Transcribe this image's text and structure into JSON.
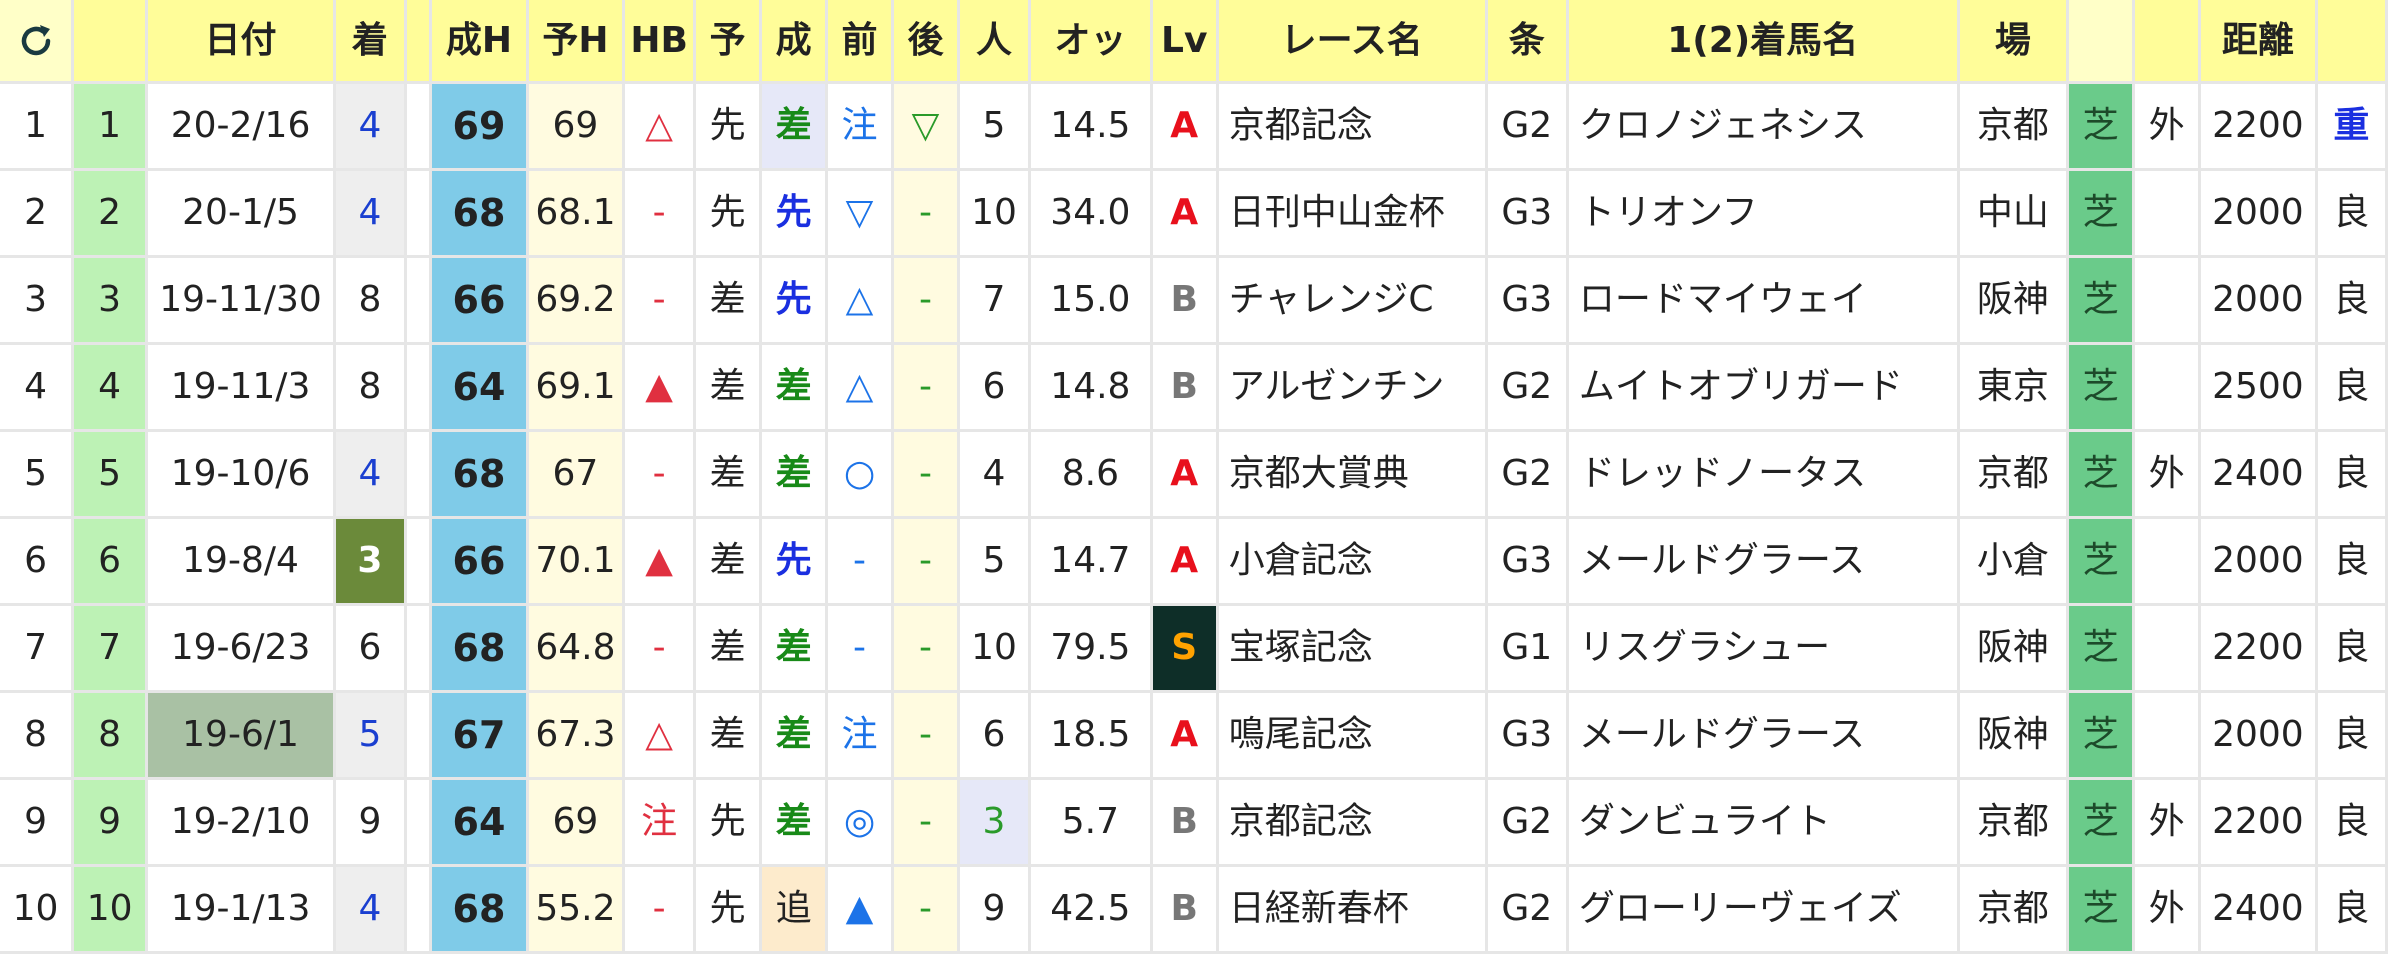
{
  "headers": {
    "date": "日付",
    "finish": "着",
    "seih": "成H",
    "yoh": "予H",
    "hb": "HB",
    "yo": "予",
    "sei": "成",
    "mae": "前",
    "ato": "後",
    "pop": "人",
    "odds": "オッ",
    "lv": "Lv",
    "race": "レース名",
    "jo": "条",
    "winner": "1(2)着馬名",
    "venue": "場",
    "dist": "距離"
  },
  "rows": [
    {
      "no": "1",
      "idx": "1",
      "date": "20-2/16",
      "finish": "4",
      "seih": "69",
      "yoh": "69",
      "hb": "△",
      "yo": "先",
      "sei": "差",
      "mae": "注",
      "ato": "▽",
      "pop": "5",
      "odds": "14.5",
      "lv": "A",
      "race": "京都記念",
      "jo": "G2",
      "winner": "クロノジェネシス",
      "venue": "京都",
      "surface": "芝",
      "course": "外",
      "dist": "2200",
      "cond": "重"
    },
    {
      "no": "2",
      "idx": "2",
      "date": "20-1/5",
      "finish": "4",
      "seih": "68",
      "yoh": "68.1",
      "hb": "-",
      "yo": "先",
      "sei": "先",
      "mae": "▽",
      "ato": "-",
      "pop": "10",
      "odds": "34.0",
      "lv": "A",
      "race": "日刊中山金杯",
      "jo": "G3",
      "winner": "トリオンフ",
      "venue": "中山",
      "surface": "芝",
      "course": "",
      "dist": "2000",
      "cond": "良"
    },
    {
      "no": "3",
      "idx": "3",
      "date": "19-11/30",
      "finish": "8",
      "seih": "66",
      "yoh": "69.2",
      "hb": "-",
      "yo": "差",
      "sei": "先",
      "mae": "△",
      "ato": "-",
      "pop": "7",
      "odds": "15.0",
      "lv": "B",
      "race": "チャレンジC",
      "jo": "G3",
      "winner": "ロードマイウェイ",
      "venue": "阪神",
      "surface": "芝",
      "course": "",
      "dist": "2000",
      "cond": "良"
    },
    {
      "no": "4",
      "idx": "4",
      "date": "19-11/3",
      "finish": "8",
      "seih": "64",
      "yoh": "69.1",
      "hb": "▲",
      "yo": "差",
      "sei": "差",
      "mae": "△",
      "ato": "-",
      "pop": "6",
      "odds": "14.8",
      "lv": "B",
      "race": "アルゼンチン",
      "jo": "G2",
      "winner": "ムイトオブリガード",
      "venue": "東京",
      "surface": "芝",
      "course": "",
      "dist": "2500",
      "cond": "良"
    },
    {
      "no": "5",
      "idx": "5",
      "date": "19-10/6",
      "finish": "4",
      "seih": "68",
      "yoh": "67",
      "hb": "-",
      "yo": "差",
      "sei": "差",
      "mae": "○",
      "ato": "-",
      "pop": "4",
      "odds": "8.6",
      "lv": "A",
      "race": "京都大賞典",
      "jo": "G2",
      "winner": "ドレッドノータス",
      "venue": "京都",
      "surface": "芝",
      "course": "外",
      "dist": "2400",
      "cond": "良"
    },
    {
      "no": "6",
      "idx": "6",
      "date": "19-8/4",
      "finish": "3",
      "seih": "66",
      "yoh": "70.1",
      "hb": "▲",
      "yo": "差",
      "sei": "先",
      "mae": "-",
      "ato": "-",
      "pop": "5",
      "odds": "14.7",
      "lv": "A",
      "race": "小倉記念",
      "jo": "G3",
      "winner": "メールドグラース",
      "venue": "小倉",
      "surface": "芝",
      "course": "",
      "dist": "2000",
      "cond": "良"
    },
    {
      "no": "7",
      "idx": "7",
      "date": "19-6/23",
      "finish": "6",
      "seih": "68",
      "yoh": "64.8",
      "hb": "-",
      "yo": "差",
      "sei": "差",
      "mae": "-",
      "ato": "-",
      "pop": "10",
      "odds": "79.5",
      "lv": "S",
      "race": "宝塚記念",
      "jo": "G1",
      "winner": "リスグラシュー",
      "venue": "阪神",
      "surface": "芝",
      "course": "",
      "dist": "2200",
      "cond": "良"
    },
    {
      "no": "8",
      "idx": "8",
      "date": "19-6/1",
      "finish": "5",
      "seih": "67",
      "yoh": "67.3",
      "hb": "△",
      "yo": "差",
      "sei": "差",
      "mae": "注",
      "ato": "-",
      "pop": "6",
      "odds": "18.5",
      "lv": "A",
      "race": "鳴尾記念",
      "jo": "G3",
      "winner": "メールドグラース",
      "venue": "阪神",
      "surface": "芝",
      "course": "",
      "dist": "2000",
      "cond": "良"
    },
    {
      "no": "9",
      "idx": "9",
      "date": "19-2/10",
      "finish": "9",
      "seih": "64",
      "yoh": "69",
      "hb": "注",
      "yo": "先",
      "sei": "差",
      "mae": "◎",
      "ato": "-",
      "pop": "3",
      "odds": "5.7",
      "lv": "B",
      "race": "京都記念",
      "jo": "G2",
      "winner": "ダンビュライト",
      "venue": "京都",
      "surface": "芝",
      "course": "外",
      "dist": "2200",
      "cond": "良"
    },
    {
      "no": "10",
      "idx": "10",
      "date": "19-1/13",
      "finish": "4",
      "seih": "68",
      "yoh": "55.2",
      "hb": "-",
      "yo": "先",
      "sei": "追",
      "mae": "▲",
      "ato": "-",
      "pop": "9",
      "odds": "42.5",
      "lv": "B",
      "race": "日経新春杯",
      "jo": "G2",
      "winner": "グローリーヴェイズ",
      "venue": "京都",
      "surface": "芝",
      "course": "外",
      "dist": "2400",
      "cond": "良"
    }
  ]
}
